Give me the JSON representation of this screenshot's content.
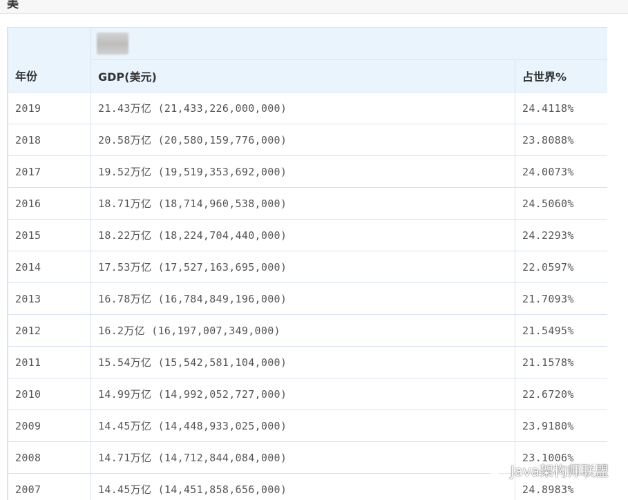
{
  "page": {
    "breadcrumb": "美"
  },
  "table": {
    "headers": {
      "year": "年份",
      "gdp": "GDP(美元)",
      "share": "占世界%"
    },
    "rows": [
      {
        "year": "2019",
        "gdp": "21.43万亿 (21,433,226,000,000)",
        "share": "24.4118%"
      },
      {
        "year": "2018",
        "gdp": "20.58万亿 (20,580,159,776,000)",
        "share": "23.8088%"
      },
      {
        "year": "2017",
        "gdp": "19.52万亿 (19,519,353,692,000)",
        "share": "24.0073%"
      },
      {
        "year": "2016",
        "gdp": "18.71万亿 (18,714,960,538,000)",
        "share": "24.5060%"
      },
      {
        "year": "2015",
        "gdp": "18.22万亿 (18,224,704,440,000)",
        "share": "24.2293%"
      },
      {
        "year": "2014",
        "gdp": "17.53万亿 (17,527,163,695,000)",
        "share": "22.0597%"
      },
      {
        "year": "2013",
        "gdp": "16.78万亿 (16,784,849,196,000)",
        "share": "21.7093%"
      },
      {
        "year": "2012",
        "gdp": "16.2万亿 (16,197,007,349,000)",
        "share": "21.5495%"
      },
      {
        "year": "2011",
        "gdp": "15.54万亿 (15,542,581,104,000)",
        "share": "21.1578%"
      },
      {
        "year": "2010",
        "gdp": "14.99万亿 (14,992,052,727,000)",
        "share": "22.6720%"
      },
      {
        "year": "2009",
        "gdp": "14.45万亿 (14,448,933,025,000)",
        "share": "23.9180%"
      },
      {
        "year": "2008",
        "gdp": "14.71万亿 (14,712,844,084,000)",
        "share": "23.1006%"
      },
      {
        "year": "2007",
        "gdp": "14.45万亿 (14,451,858,656,000)",
        "share": "24.8983%"
      }
    ]
  },
  "watermark": {
    "text": "Java架构师联盟",
    "icon": "wechat-icon"
  }
}
